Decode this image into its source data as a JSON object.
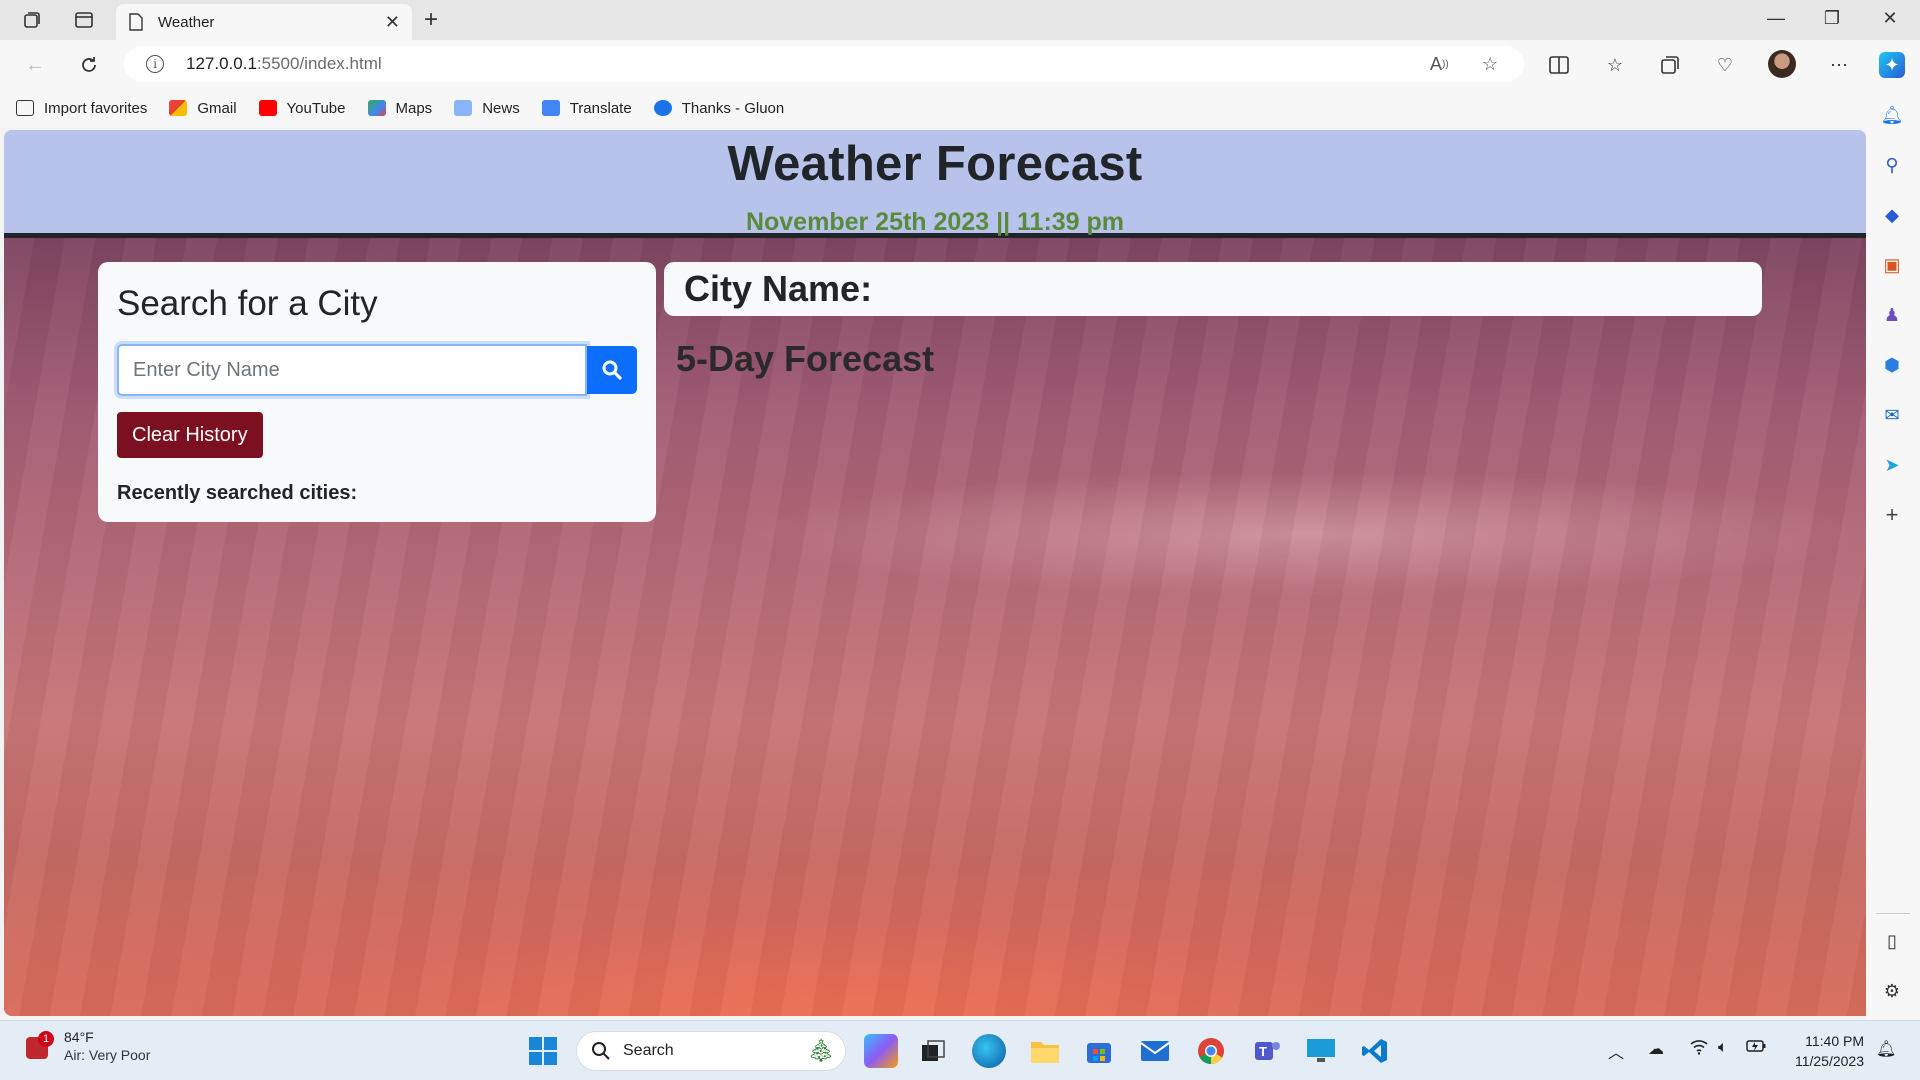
{
  "browser": {
    "tab_title": "Weather",
    "url_host": "127.0.0.1",
    "url_path": ":5500/index.html",
    "read_aloud_label": "A",
    "favorites": [
      {
        "label": "Import favorites",
        "icon": "import-icon"
      },
      {
        "label": "Gmail",
        "icon": "gmail-icon"
      },
      {
        "label": "YouTube",
        "icon": "youtube-icon"
      },
      {
        "label": "Maps",
        "icon": "maps-icon"
      },
      {
        "label": "News",
        "icon": "news-icon"
      },
      {
        "label": "Translate",
        "icon": "translate-icon"
      },
      {
        "label": "Thanks - Gluon",
        "icon": "gluon-icon"
      }
    ]
  },
  "page": {
    "title": "Weather Forecast",
    "date_line": "November 25th 2023 || 11:39 pm",
    "search": {
      "heading": "Search for a City",
      "placeholder": "Enter City Name",
      "clear_label": "Clear History",
      "recent_label": "Recently searched cities:"
    },
    "city_heading": "City Name:",
    "forecast_heading": "5-Day Forecast"
  },
  "taskbar": {
    "weather_temp": "84°F",
    "weather_air": "Air: Very Poor",
    "weather_badge": "1",
    "search_label": "Search",
    "time": "11:40 PM",
    "date": "11/25/2023"
  },
  "colors": {
    "header_bg": "#b7c3ea",
    "date_green": "#5a8a3c",
    "search_blue": "#0d6efd",
    "clear_red": "#7d1020"
  }
}
